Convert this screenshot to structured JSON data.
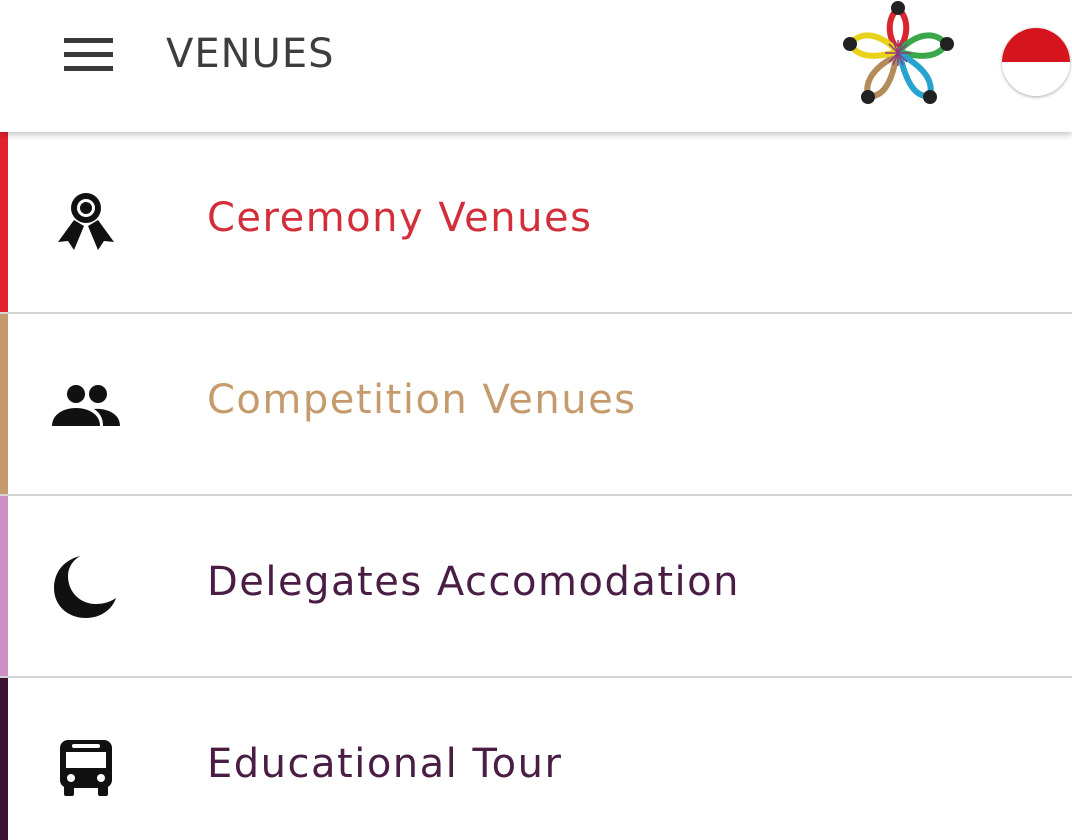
{
  "header": {
    "title": "VENUES",
    "menu_icon": "hamburger-menu-icon",
    "logo_icon": "flower-logo-icon",
    "language_flag": "indonesia-flag-icon"
  },
  "colors": {
    "ceremony": "#d32f3a",
    "competition": "#c59b6d",
    "accommodation": "#cf8fc4",
    "tour": "#3c1437",
    "label_dark": "#4a1d45"
  },
  "menu": {
    "items": [
      {
        "label": "Ceremony Venues",
        "icon": "award-ribbon-icon"
      },
      {
        "label": "Competition Venues",
        "icon": "people-group-icon"
      },
      {
        "label": "Delegates Accomodation",
        "icon": "moon-icon"
      },
      {
        "label": "Educational Tour",
        "icon": "bus-icon"
      }
    ]
  }
}
